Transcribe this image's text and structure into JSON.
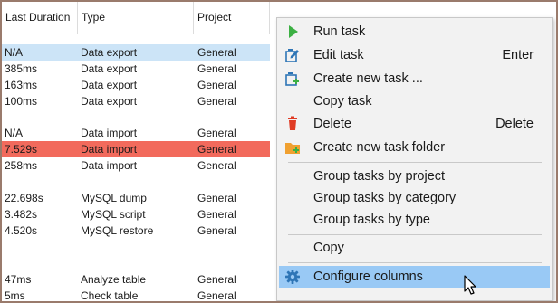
{
  "table": {
    "columns": [
      "Last Duration",
      "Type",
      "Project"
    ],
    "rows": [
      {
        "duration": "N/A",
        "type": "Data export",
        "project": "General",
        "state": "selected"
      },
      {
        "duration": "385ms",
        "type": "Data export",
        "project": "General",
        "state": ""
      },
      {
        "duration": "163ms",
        "type": "Data export",
        "project": "General",
        "state": ""
      },
      {
        "duration": "100ms",
        "type": "Data export",
        "project": "General",
        "state": ""
      },
      {
        "duration": "N/A",
        "type": "Data import",
        "project": "General",
        "state": ""
      },
      {
        "duration": "7.529s",
        "type": "Data import",
        "project": "General",
        "state": "error"
      },
      {
        "duration": "258ms",
        "type": "Data import",
        "project": "General",
        "state": ""
      },
      {
        "duration": "22.698s",
        "type": "MySQL dump",
        "project": "General",
        "state": ""
      },
      {
        "duration": "3.482s",
        "type": "MySQL script",
        "project": "General",
        "state": ""
      },
      {
        "duration": "4.520s",
        "type": "MySQL restore",
        "project": "General",
        "state": ""
      },
      {
        "duration": "47ms",
        "type": "Analyze table",
        "project": "General",
        "state": ""
      },
      {
        "duration": "5ms",
        "type": "Check table",
        "project": "General",
        "state": ""
      }
    ]
  },
  "menu": {
    "items": [
      {
        "label": "Run task",
        "shortcut": "",
        "icon": "run-icon"
      },
      {
        "label": "Edit task",
        "shortcut": "Enter",
        "icon": "edit-task-icon"
      },
      {
        "label": "Create new task ...",
        "shortcut": "",
        "icon": "create-task-icon"
      },
      {
        "label": "Copy task",
        "shortcut": "",
        "icon": ""
      },
      {
        "label": "Delete",
        "shortcut": "Delete",
        "icon": "trash-icon"
      },
      {
        "label": "Create new task folder",
        "shortcut": "",
        "icon": "new-folder-icon"
      },
      {
        "label": "Group tasks by project",
        "shortcut": "",
        "icon": ""
      },
      {
        "label": "Group tasks by category",
        "shortcut": "",
        "icon": ""
      },
      {
        "label": "Group tasks by type",
        "shortcut": "",
        "icon": ""
      },
      {
        "label": "Copy",
        "shortcut": "",
        "icon": ""
      },
      {
        "label": "Configure columns",
        "shortcut": "",
        "icon": "gear-icon"
      }
    ]
  },
  "colors": {
    "selected_row": "#cce4f7",
    "error_row": "#f26a5c",
    "menu_highlight": "#99c9f5",
    "run_icon": "#3cb043",
    "delete_icon": "#e03b24",
    "folder_icon": "#f0a030",
    "accent_icon": "#2e75b6"
  }
}
